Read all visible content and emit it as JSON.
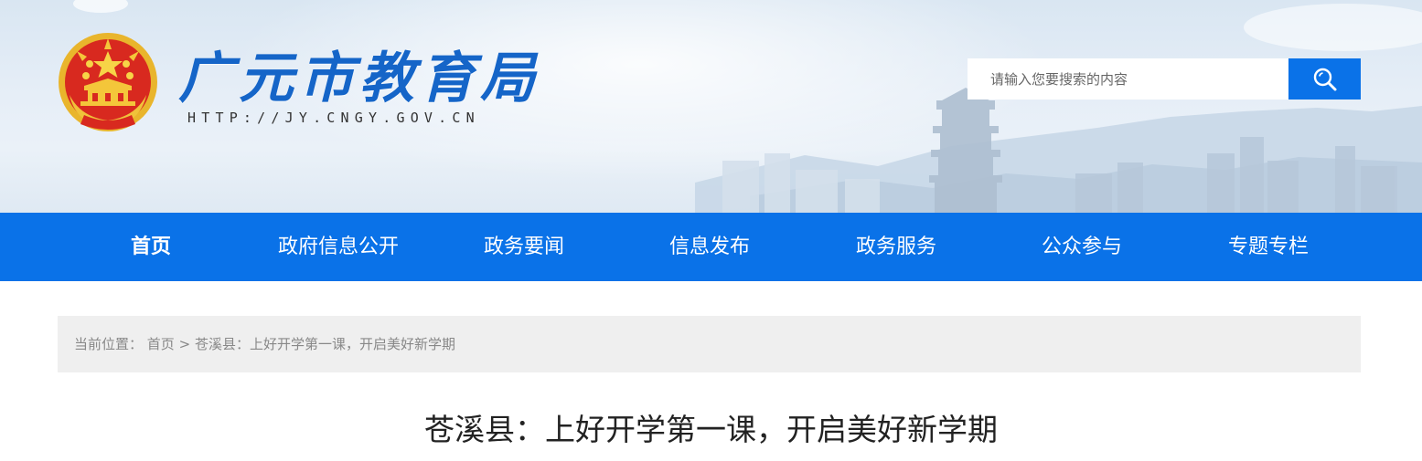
{
  "header": {
    "site_title": "广元市教育局",
    "site_url": "HTTP://JY.CNGY.GOV.CN",
    "emblem_icon": "national-emblem-icon",
    "search": {
      "placeholder": "请输入您要搜索的内容",
      "value": "",
      "button_icon": "search-icon"
    }
  },
  "nav": {
    "items": [
      {
        "label": "首页",
        "active": true
      },
      {
        "label": "政府信息公开",
        "active": false
      },
      {
        "label": "政务要闻",
        "active": false
      },
      {
        "label": "信息发布",
        "active": false
      },
      {
        "label": "政务服务",
        "active": false
      },
      {
        "label": "公众参与",
        "active": false
      },
      {
        "label": "专题专栏",
        "active": false
      }
    ]
  },
  "breadcrumb": {
    "prefix": "当前位置：",
    "home": "首页",
    "separator": ">",
    "current": "苍溪县：上好开学第一课，开启美好新学期"
  },
  "article": {
    "title": "苍溪县：上好开学第一课，开启美好新学期"
  },
  "colors": {
    "primary": "#0a72e8",
    "title_blue": "#1565c8",
    "breadcrumb_bg": "#efefef"
  }
}
